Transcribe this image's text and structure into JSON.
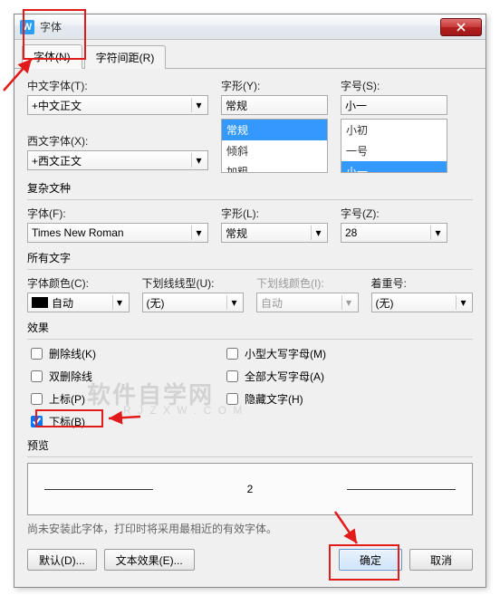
{
  "window": {
    "title": "字体",
    "app_icon_letter": "W"
  },
  "tabs": {
    "font": "字体(N)",
    "spacing": "字符间距(R)"
  },
  "labels": {
    "cn_font": "中文字体(T):",
    "style": "字形(Y):",
    "size": "字号(S):",
    "latin_font": "西文字体(X):",
    "complex_group": "复杂文种",
    "complex_font": "字体(F):",
    "complex_style": "字形(L):",
    "complex_size": "字号(Z):",
    "all_fonts_group": "所有文字",
    "font_color": "字体颜色(C):",
    "underline_style": "下划线线型(U):",
    "underline_color": "下划线颜色(I):",
    "emphasis": "着重号:",
    "effects_group": "效果",
    "preview_label": "预览"
  },
  "values": {
    "cn_font": "+中文正文",
    "style": "常规",
    "size": "小一",
    "latin_font": "+西文正文",
    "complex_font": "Times New Roman",
    "complex_style": "常规",
    "complex_size": "28",
    "font_color": "自动",
    "underline_style": "(无)",
    "underline_color": "自动",
    "emphasis": "(无)",
    "preview_text": "2"
  },
  "size_list": [
    "小初",
    "一号",
    "小一"
  ],
  "style_list": [
    "常规",
    "倾斜",
    "加粗"
  ],
  "effects": {
    "strike": "删除线(K)",
    "dstrike": "双删除线",
    "super": "上标(P)",
    "sub": "下标(B)",
    "smallcaps": "小型大写字母(M)",
    "allcaps": "全部大写字母(A)",
    "hidden": "隐藏文字(H)"
  },
  "checked": {
    "sub": true
  },
  "note": "尚未安装此字体，打印时将采用最相近的有效字体。",
  "buttons": {
    "default": "默认(D)...",
    "texteffect": "文本效果(E)...",
    "ok": "确定",
    "cancel": "取消"
  },
  "watermark": {
    "main": "软件自学网",
    "sub": "R J Z X W . C O M"
  }
}
